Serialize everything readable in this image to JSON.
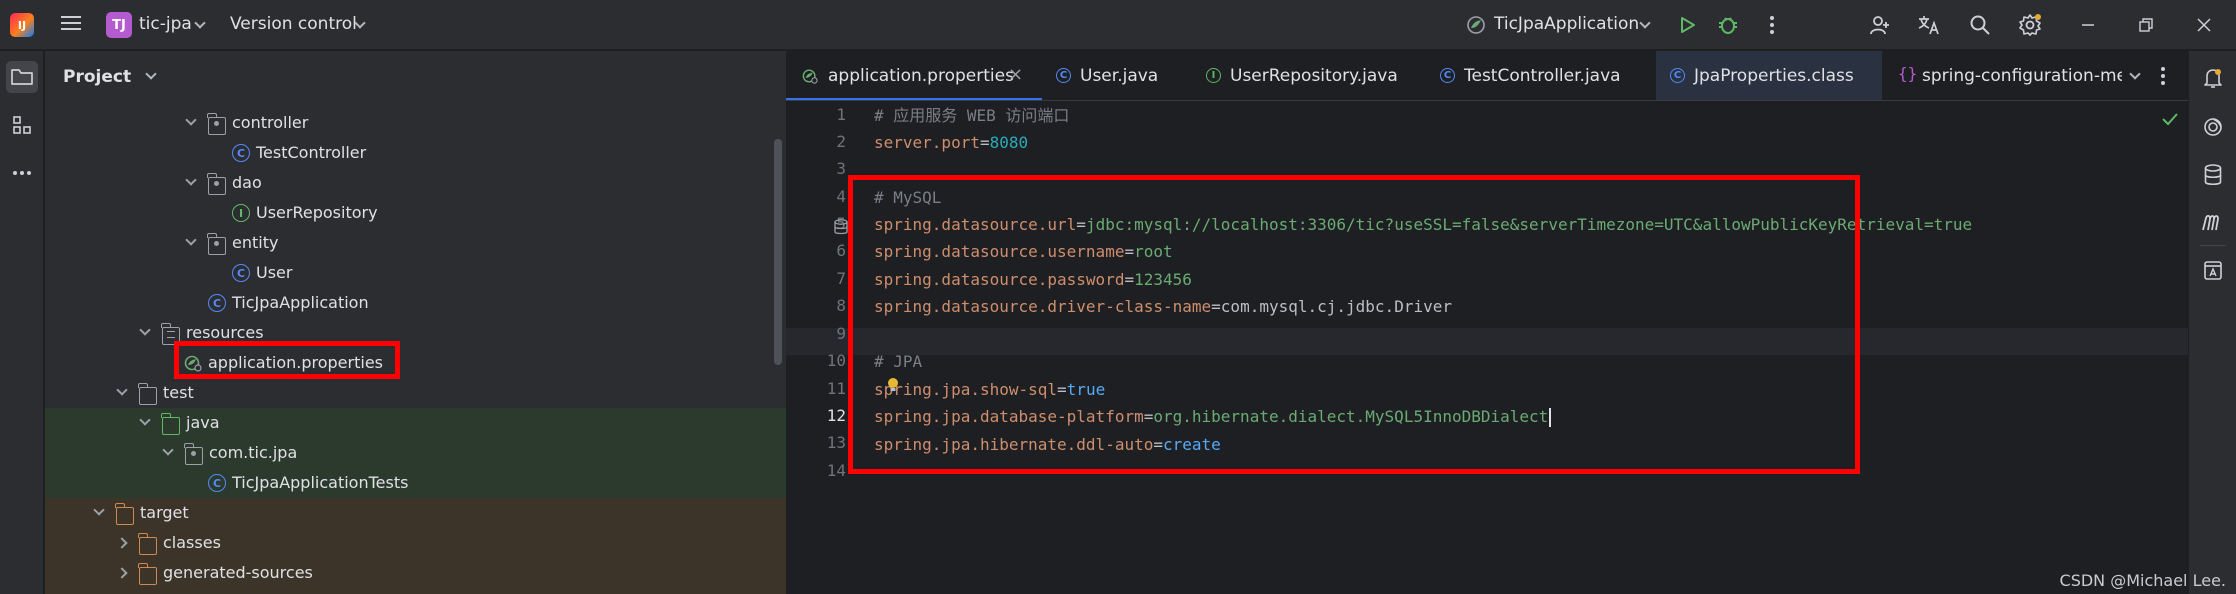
{
  "titlebar": {
    "project_badge": "TJ",
    "project_name": "tic-jpa",
    "vcs": "Version control",
    "run_config": "TicJpaApplication"
  },
  "project_panel": {
    "title": "Project",
    "tree": [
      {
        "label": "controller",
        "icon": "package-folder-icon",
        "state": "open"
      },
      {
        "label": "TestController",
        "icon": "class-icon"
      },
      {
        "label": "dao",
        "icon": "package-folder-icon",
        "state": "open"
      },
      {
        "label": "UserRepository",
        "icon": "interface-icon"
      },
      {
        "label": "entity",
        "icon": "package-folder-icon",
        "state": "open"
      },
      {
        "label": "User",
        "icon": "class-icon"
      },
      {
        "label": "TicJpaApplication",
        "icon": "spring-boot-class-icon"
      },
      {
        "label": "resources",
        "icon": "resources-folder-icon",
        "state": "open"
      },
      {
        "label": "application.properties",
        "icon": "spring-properties-icon"
      },
      {
        "label": "test",
        "icon": "folder-icon",
        "state": "open"
      },
      {
        "label": "java",
        "icon": "test-source-folder-icon",
        "state": "open"
      },
      {
        "label": "com.tic.jpa",
        "icon": "package-folder-icon",
        "state": "open"
      },
      {
        "label": "TicJpaApplicationTests",
        "icon": "class-icon"
      },
      {
        "label": "target",
        "icon": "excluded-folder-icon",
        "state": "open"
      },
      {
        "label": "classes",
        "icon": "excluded-folder-icon",
        "state": "closed"
      },
      {
        "label": "generated-sources",
        "icon": "excluded-folder-icon",
        "state": "closed"
      }
    ]
  },
  "editor": {
    "tabs": [
      {
        "label": "application.properties",
        "icon": "spring-properties-icon",
        "active": true
      },
      {
        "label": "User.java",
        "icon": "class-icon"
      },
      {
        "label": "UserRepository.java",
        "icon": "interface-icon"
      },
      {
        "label": "TestController.java",
        "icon": "class-icon"
      },
      {
        "label": "JpaProperties.class",
        "icon": "class-icon"
      },
      {
        "label": "spring-configuration-me",
        "icon": "json-icon"
      }
    ],
    "tab_close_glyph": "×",
    "line_numbers": [
      "1",
      "2",
      "3",
      "4",
      "5",
      "6",
      "7",
      "8",
      "9",
      "10",
      "11",
      "12",
      "13",
      "14"
    ],
    "current_line": "12",
    "lines": {
      "l1": "# 应用服务 WEB 访问端口",
      "l2": {
        "key": "server.port",
        "eq": "=",
        "val": "8080"
      },
      "l4": "# MySQL",
      "l5": {
        "key": "spring.datasource.url",
        "eq": "=",
        "val": "jdbc:mysql://localhost:3306/tic?useSSL=false&serverTimezone=UTC&allowPublicKeyRetrieval=true"
      },
      "l6": {
        "key": "spring.datasource.username",
        "eq": "=",
        "val": "root"
      },
      "l7": {
        "key": "spring.datasource.password",
        "eq": "=",
        "val": "123456"
      },
      "l8": {
        "key": "spring.datasource.driver-class-name",
        "eq": "=",
        "val": "com.mysql.cj.jdbc.Driver"
      },
      "l10": "# JPA",
      "l11": {
        "key": "spring.jpa.show-sql",
        "eq": "=",
        "val": "true"
      },
      "l12": {
        "key": "spring.jpa.database-platform",
        "eq": "=",
        "val": "org.hibernate.dialect.MySQL5InnoDBDialect"
      },
      "l13": {
        "key": "spring.jpa.hibernate.ddl-auto",
        "eq": "=",
        "val": "create"
      }
    }
  },
  "watermark": "CSDN @Michael Lee.",
  "colors": {
    "annotation": "#ff0000",
    "accent": "#3574f0",
    "key": "#cf8e6d",
    "value": "#6aab73",
    "number": "#2aacb8",
    "keyword_value": "#57aaf7",
    "comment": "#7a7e85"
  }
}
